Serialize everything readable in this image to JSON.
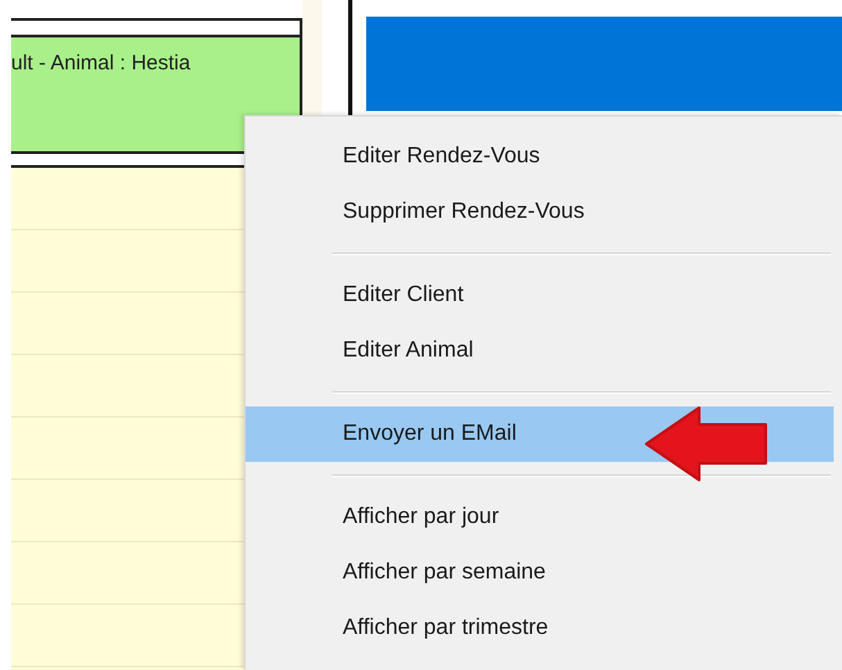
{
  "appointment": {
    "text": "ult - Animal : Hestia"
  },
  "context_menu": {
    "groups": [
      {
        "items": [
          {
            "label": "Editer Rendez-Vous",
            "selected": false
          },
          {
            "label": "Supprimer Rendez-Vous",
            "selected": false
          }
        ]
      },
      {
        "items": [
          {
            "label": "Editer Client",
            "selected": false
          },
          {
            "label": "Editer Animal",
            "selected": false
          }
        ]
      },
      {
        "items": [
          {
            "label": "Envoyer un EMail",
            "selected": true
          }
        ]
      },
      {
        "items": [
          {
            "label": "Afficher par jour",
            "selected": false
          },
          {
            "label": "Afficher par semaine",
            "selected": false
          },
          {
            "label": "Afficher par trimestre",
            "selected": false
          }
        ]
      }
    ]
  }
}
